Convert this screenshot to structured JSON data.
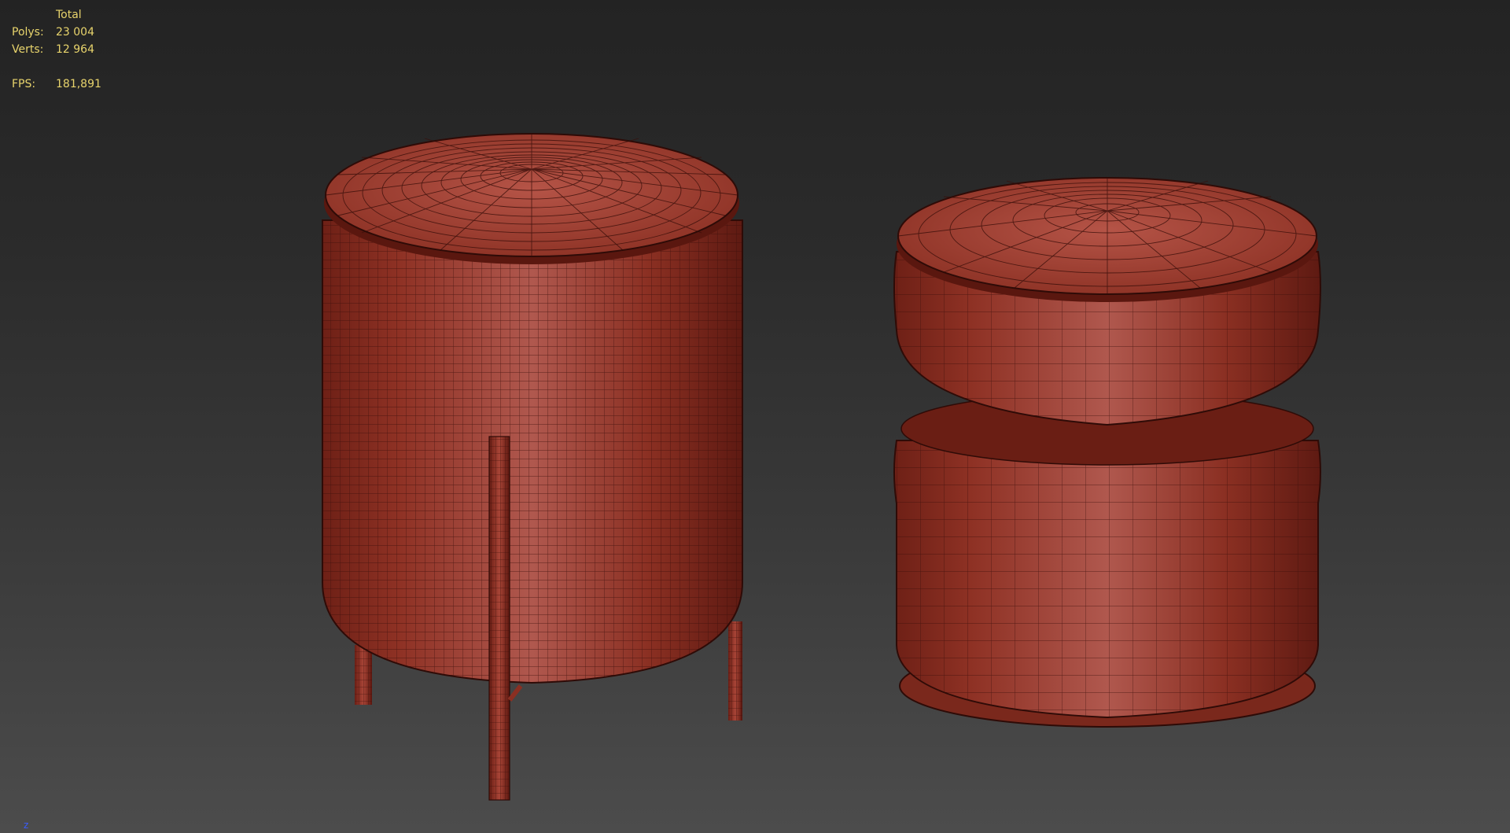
{
  "viewport": {
    "stats": {
      "header": "Total",
      "polys_label": "Polys:",
      "polys_value": "23 004",
      "verts_label": "Verts:",
      "verts_value": "12 964",
      "fps_label": "FPS:",
      "fps_value": "181,891"
    },
    "axis_label": "z",
    "colors": {
      "mesh_fill": "#9c3a2c",
      "wire": "#3a0f0a",
      "stats_text": "#e8d46c",
      "axis": "#3a5cff"
    }
  }
}
